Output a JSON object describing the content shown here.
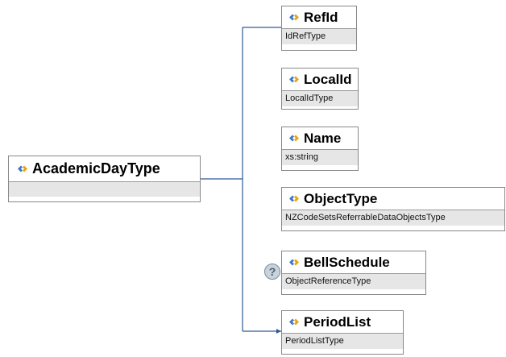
{
  "root": {
    "name": "AcademicDayType",
    "icon": "element-diamond-icon"
  },
  "children": [
    {
      "name": "RefId",
      "type": "IdRefType",
      "icon": "element-diamond-icon",
      "optional": false
    },
    {
      "name": "LocalId",
      "type": "LocalIdType",
      "icon": "element-diamond-icon",
      "optional": false
    },
    {
      "name": "Name",
      "type": "xs:string",
      "icon": "element-diamond-icon",
      "optional": false
    },
    {
      "name": "ObjectType",
      "type": "NZCodeSetsReferrableDataObjectsType",
      "icon": "element-diamond-icon",
      "optional": false
    },
    {
      "name": "BellSchedule",
      "type": "ObjectReferenceType",
      "icon": "element-diamond-icon",
      "optional": true,
      "optional_marker": "?"
    },
    {
      "name": "PeriodList",
      "type": "PeriodListType",
      "icon": "element-diamond-icon",
      "optional": false
    }
  ],
  "colors": {
    "connector": "#2f5b93",
    "icon_blue": "#3a78c8",
    "icon_gold": "#e7a414"
  }
}
